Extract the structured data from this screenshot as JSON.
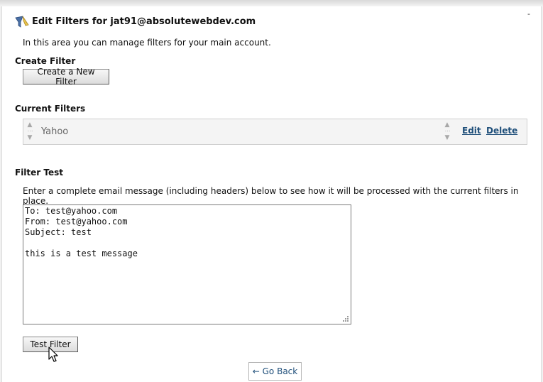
{
  "page": {
    "title": "Edit Filters for jat91@absolutewebdev.com",
    "intro": "In this area you can manage filters for your main account.",
    "corner_mark": "-"
  },
  "create_filter": {
    "heading": "Create Filter",
    "button_label": "Create a New Filter"
  },
  "current_filters": {
    "heading": "Current Filters",
    "items": [
      {
        "name": "Yahoo",
        "edit_label": "Edit",
        "delete_label": "Delete"
      }
    ]
  },
  "filter_test": {
    "heading": "Filter Test",
    "description": "Enter a complete email message (including headers) below to see how it will be processed with the current filters in place.",
    "message": "To: test@yahoo.com\nFrom: test@yahoo.com\nSubject: test\n\nthis is a test message",
    "button_label": "Test Filter"
  },
  "footer": {
    "go_back_label": "← Go Back"
  },
  "colors": {
    "link": "#1f4f7a",
    "filter_row_bg": "#f4f4f4"
  },
  "icons": {
    "title_icon": "filter-funnel-icon",
    "drag_handle": "drag-handle-icon",
    "cursor": "mouse-pointer-icon"
  }
}
